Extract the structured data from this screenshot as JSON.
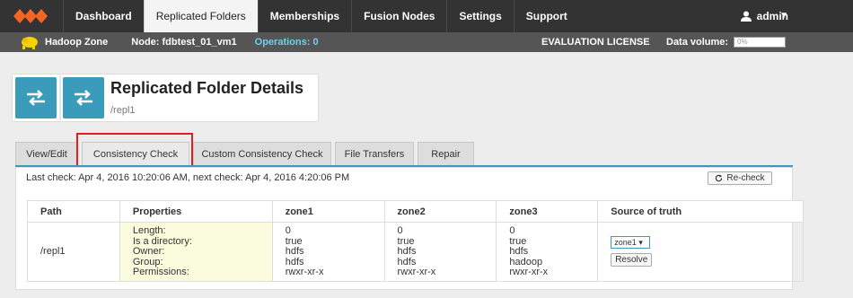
{
  "nav": {
    "items": [
      {
        "label": "Dashboard"
      },
      {
        "label": "Replicated Folders",
        "active": true
      },
      {
        "label": "Memberships"
      },
      {
        "label": "Fusion Nodes"
      },
      {
        "label": "Settings"
      },
      {
        "label": "Support"
      }
    ],
    "user": "admin",
    "brand_color": "#f26522"
  },
  "subbar": {
    "zone": "Hadoop Zone",
    "node": "Node: fdbtest_01_vm1",
    "operations": "Operations: 0",
    "license": "EVALUATION LICENSE",
    "data_volume_label": "Data volume:",
    "data_volume_value": "0%"
  },
  "page": {
    "title": "Replicated Folder Details",
    "subtitle": "/repl1"
  },
  "tabs": [
    {
      "label": "View/Edit"
    },
    {
      "label": "Consistency Check",
      "active": true
    },
    {
      "label": "Custom Consistency Check"
    },
    {
      "label": "File Transfers"
    },
    {
      "label": "Repair"
    }
  ],
  "check": {
    "last_check": "Last check: Apr 4, 2016 10:20:06 AM, next check: Apr 4, 2016 4:20:06 PM",
    "recheck_label": "Re-check"
  },
  "table": {
    "headers": [
      "Path",
      "Properties",
      "zone1",
      "zone2",
      "zone3",
      "Source of truth"
    ],
    "row": {
      "path": "/repl1",
      "properties": [
        "Length:",
        "Is a directory:",
        "Owner:",
        "Group:",
        "Permissions:"
      ],
      "zone1": [
        "0",
        "true",
        "hdfs",
        "hdfs",
        "rwxr-xr-x"
      ],
      "zone2": [
        "0",
        "true",
        "hdfs",
        "hdfs",
        "rwxr-xr-x"
      ],
      "zone3": [
        "0",
        "true",
        "hdfs",
        "hadoop",
        "rwxr-xr-x"
      ],
      "source_select": "zone1",
      "resolve_label": "Resolve"
    }
  }
}
